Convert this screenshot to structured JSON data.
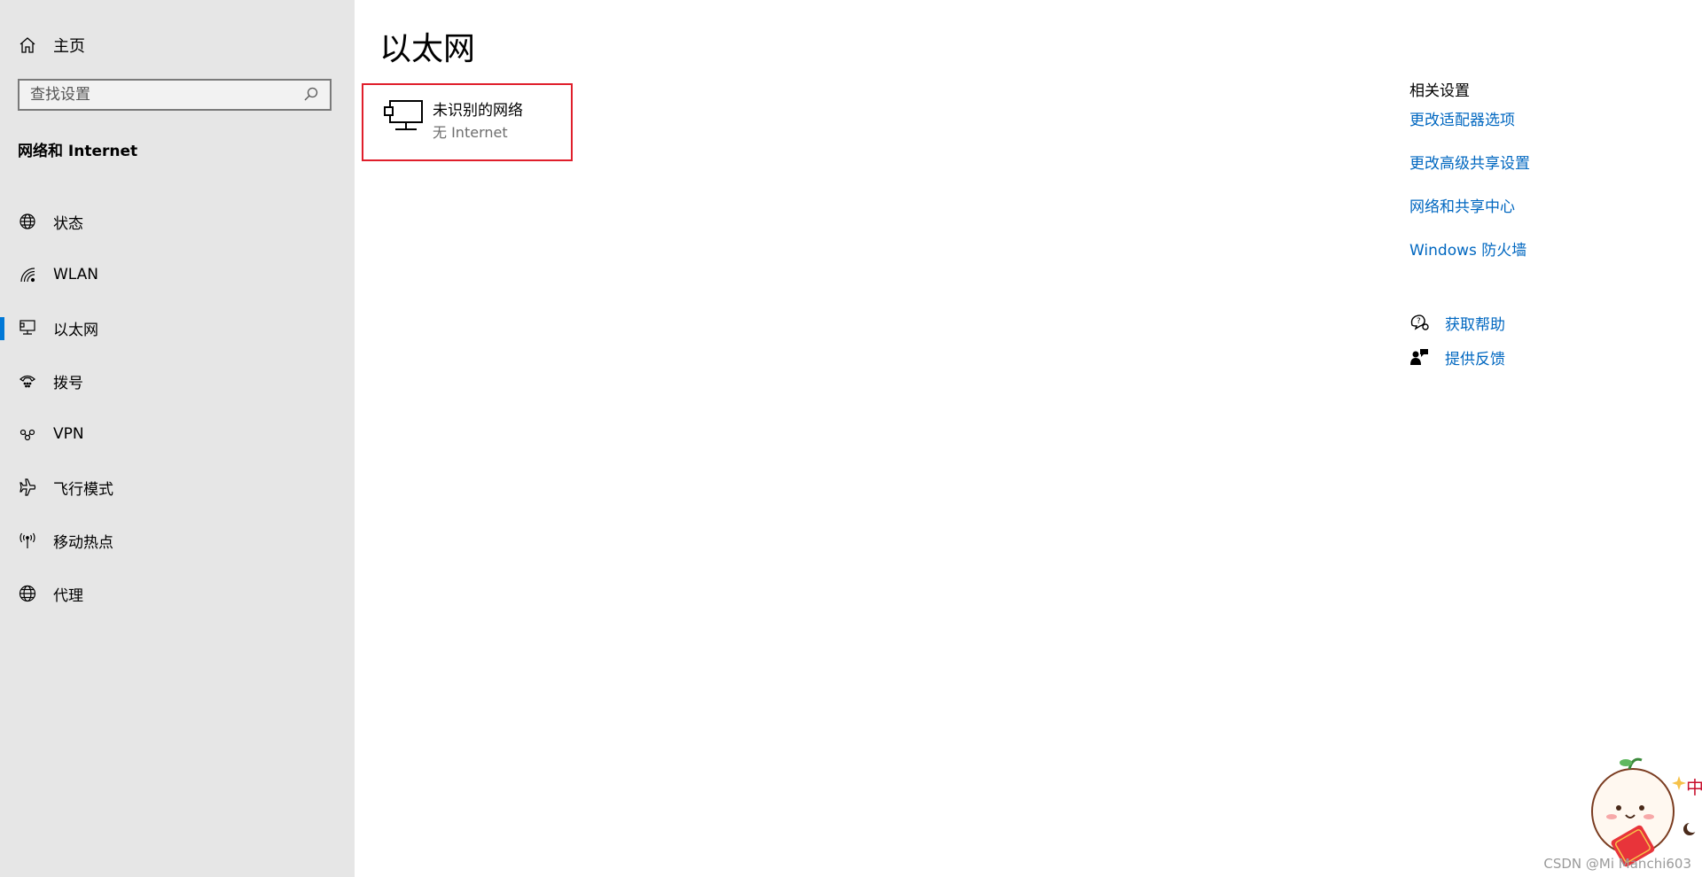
{
  "sidebar": {
    "home_label": "主页",
    "search_placeholder": "查找设置",
    "section_title": "网络和 Internet",
    "items": [
      {
        "label": "状态",
        "icon": "globe-status-icon"
      },
      {
        "label": "WLAN",
        "icon": "wifi-icon"
      },
      {
        "label": "以太网",
        "icon": "ethernet-icon",
        "active": true
      },
      {
        "label": "拨号",
        "icon": "dialup-icon"
      },
      {
        "label": "VPN",
        "icon": "vpn-icon"
      },
      {
        "label": "飞行模式",
        "icon": "airplane-icon"
      },
      {
        "label": "移动热点",
        "icon": "hotspot-icon"
      },
      {
        "label": "代理",
        "icon": "globe-icon"
      }
    ]
  },
  "main": {
    "title": "以太网",
    "network": {
      "name": "未识别的网络",
      "status": "无 Internet"
    }
  },
  "related": {
    "title": "相关设置",
    "links": [
      "更改适配器选项",
      "更改高级共享设置",
      "网络和共享中心",
      "Windows 防火墙"
    ]
  },
  "help": {
    "get_help": "获取帮助",
    "feedback": "提供反馈"
  },
  "watermark": "CSDN @Mi Manchi603",
  "colors": {
    "sidebar_bg": "#e6e6e6",
    "accent": "#0078d7",
    "link": "#0067c0",
    "highlight_border": "#e01e2b"
  }
}
